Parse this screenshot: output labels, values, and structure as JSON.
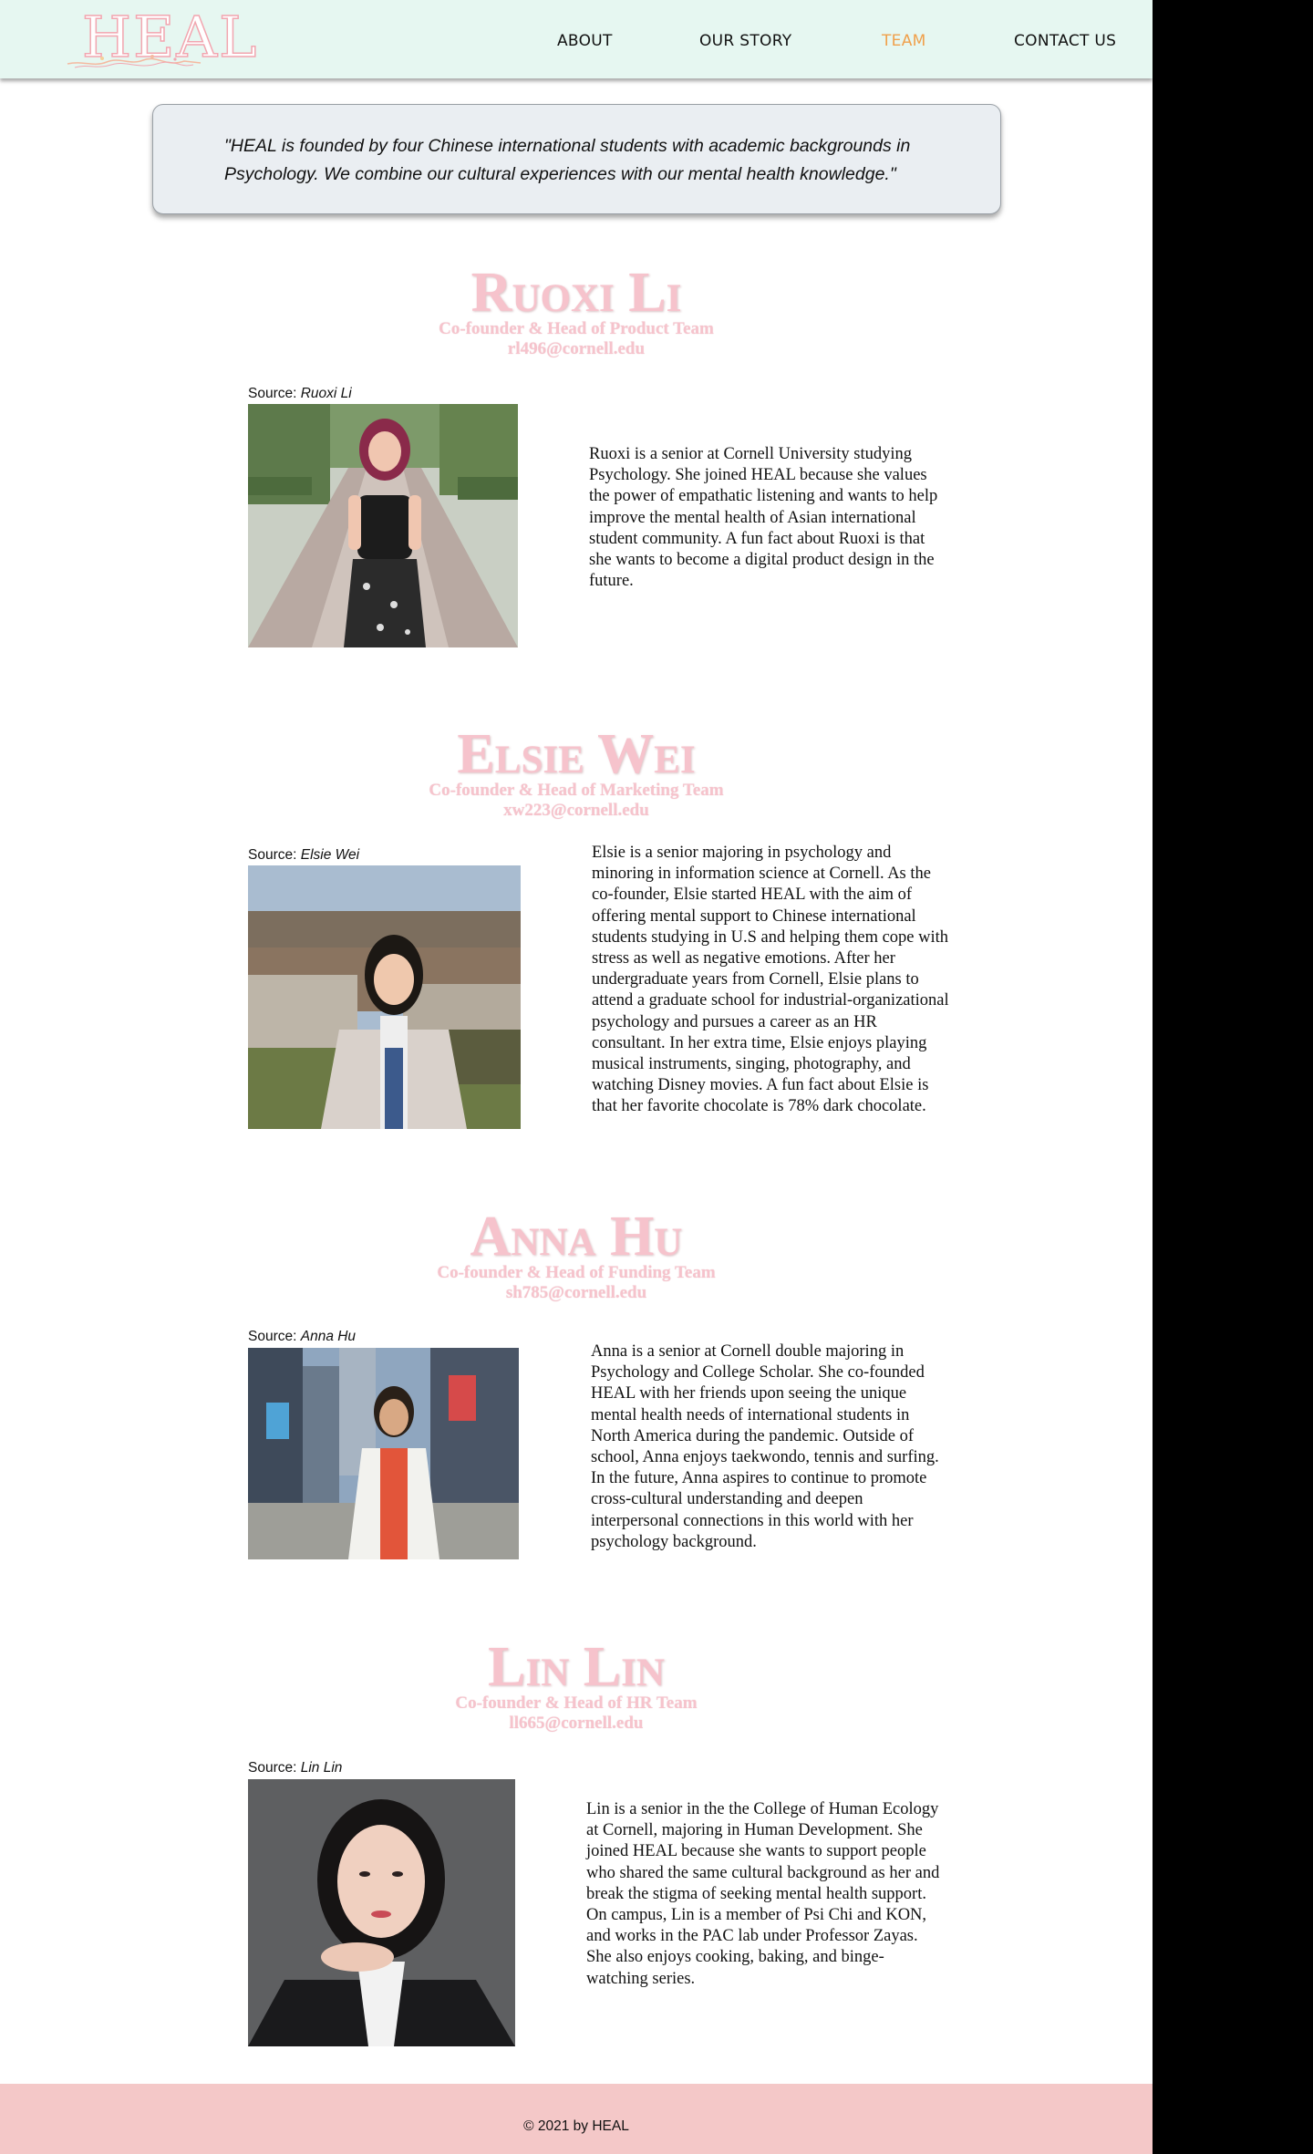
{
  "header": {
    "logo_text": "HEAL",
    "nav": [
      "ABOUT",
      "OUR STORY",
      "TEAM",
      "CONTACT US"
    ],
    "active_nav": "TEAM"
  },
  "quote": "\"HEAL is founded by four Chinese international students with academic backgrounds in Psychology. We combine our cultural experiences with our mental health knowledge.\"",
  "members": [
    {
      "name": "Ruoxi Li",
      "role": "Co-founder & Head of Product Team",
      "email": "rl496@cornell.edu",
      "source_label": "Source: ",
      "source_name": "Ruoxi Li",
      "bio": "Ruoxi is a senior at Cornell University studying Psychology. She joined HEAL because she values the power of empathatic listening and wants to help improve the mental health of Asian international student community. A fun fact about Ruoxi is that she wants to become a digital product design in the future."
    },
    {
      "name": "Elsie Wei",
      "role": "Co-founder & Head of Marketing Team",
      "email": "xw223@cornell.edu",
      "source_label": "Source: ",
      "source_name": "Elsie Wei",
      "bio": "Elsie is a senior majoring in psychology and minoring in information science at Cornell. As the co-founder, Elsie started HEAL with the aim of offering mental support to Chinese international students studying in U.S and helping them cope with stress as well as negative emotions. After her undergraduate years from Cornell, Elsie plans to attend a graduate school for industrial-organizational psychology and pursues a career as an HR consultant. In her extra time, Elsie enjoys playing musical instruments, singing, photography, and watching Disney movies. A fun fact about Elsie is that her favorite chocolate is 78% dark chocolate."
    },
    {
      "name": "Anna Hu",
      "role": "Co-founder & Head of Funding Team",
      "email": "sh785@cornell.edu",
      "source_label": "Source: ",
      "source_name": "Anna Hu",
      "bio": "Anna is a senior at Cornell double majoring in Psychology and College Scholar. She co-founded HEAL with her friends upon seeing the unique mental health needs of international students in North America during the pandemic. Outside of school, Anna enjoys taekwondo, tennis and surfing. In the future, Anna aspires to continue to promote cross-cultural understanding and deepen interpersonal connections in this world with her psychology background."
    },
    {
      "name": "Lin Lin",
      "role": "Co-founder & Head of HR Team",
      "email": "ll665@cornell.edu",
      "source_label": "Source: ",
      "source_name": "Lin Lin",
      "bio": "Lin is a senior in the the College of Human Ecology at Cornell, majoring in Human Development. She joined HEAL because she wants to support people who shared the same cultural background as her and break the stigma of seeking mental health support. On campus, Lin is a member of Psi Chi and KON, and works in the PAC lab under Professor Zayas. She also enjoys cooking, baking, and binge-watching series."
    }
  ],
  "footer": {
    "copyright": "© 2021 by HEAL"
  },
  "colors": {
    "header_bg": "#e6f7f1",
    "nav_active": "#f0a04b",
    "name_pink": "#f6c3cc",
    "quote_bg": "#eaeef2",
    "footer_bg": "#f4c8c8"
  }
}
